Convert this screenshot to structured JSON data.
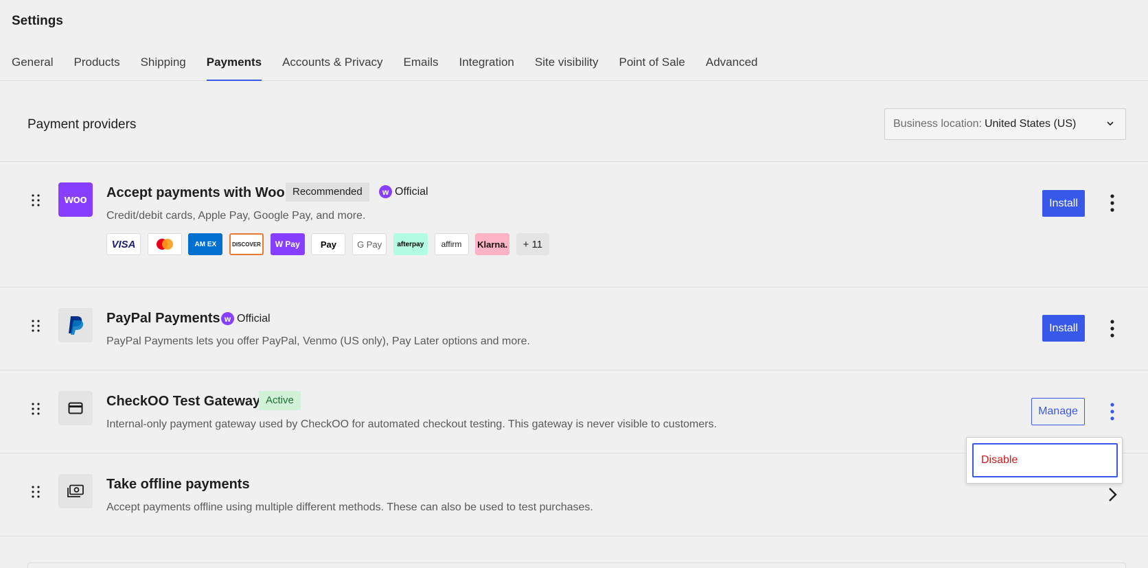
{
  "page": {
    "title": "Settings"
  },
  "tabs": [
    {
      "label": "General"
    },
    {
      "label": "Products"
    },
    {
      "label": "Shipping"
    },
    {
      "label": "Payments",
      "active": true
    },
    {
      "label": "Accounts & Privacy"
    },
    {
      "label": "Emails"
    },
    {
      "label": "Integration"
    },
    {
      "label": "Site visibility"
    },
    {
      "label": "Point of Sale"
    },
    {
      "label": "Advanced"
    }
  ],
  "providers": {
    "title": "Payment providers",
    "location": {
      "label": "Business location:",
      "value": "United States (US)"
    }
  },
  "woo": {
    "logo_text": "woo",
    "title": "Accept payments with Woo",
    "badge": "Recommended",
    "official": "Official",
    "description": "Credit/debit cards, Apple Pay, Google Pay, and more.",
    "install": "Install",
    "cards": {
      "visa": "VISA",
      "amex": "AM EX",
      "discover": "DISCOVER",
      "wpay": "W Pay",
      "apay": " Pay",
      "gpay": "G Pay",
      "afterpay": "afterpay",
      "affirm": "affirm",
      "klarna": "Klarna.",
      "more": "+ 11"
    }
  },
  "paypal": {
    "title": "PayPal Payments",
    "official": "Official",
    "description": "PayPal Payments lets you offer PayPal, Venmo (US only), Pay Later options and more.",
    "install": "Install"
  },
  "checkoo": {
    "title": "CheckOO Test Gateway",
    "badge": "Active",
    "description": "Internal-only payment gateway used by CheckOO for automated checkout testing. This gateway is never visible to customers.",
    "manage": "Manage"
  },
  "offline": {
    "title": "Take offline payments",
    "description": "Accept payments offline using multiple different methods. These can also be used to test purchases."
  },
  "popover": {
    "disable": "Disable"
  },
  "colors": {
    "accent": "#3858e9",
    "woo_purple": "#873eff",
    "danger": "#cc1818",
    "active_bg": "#d1f1d8"
  }
}
